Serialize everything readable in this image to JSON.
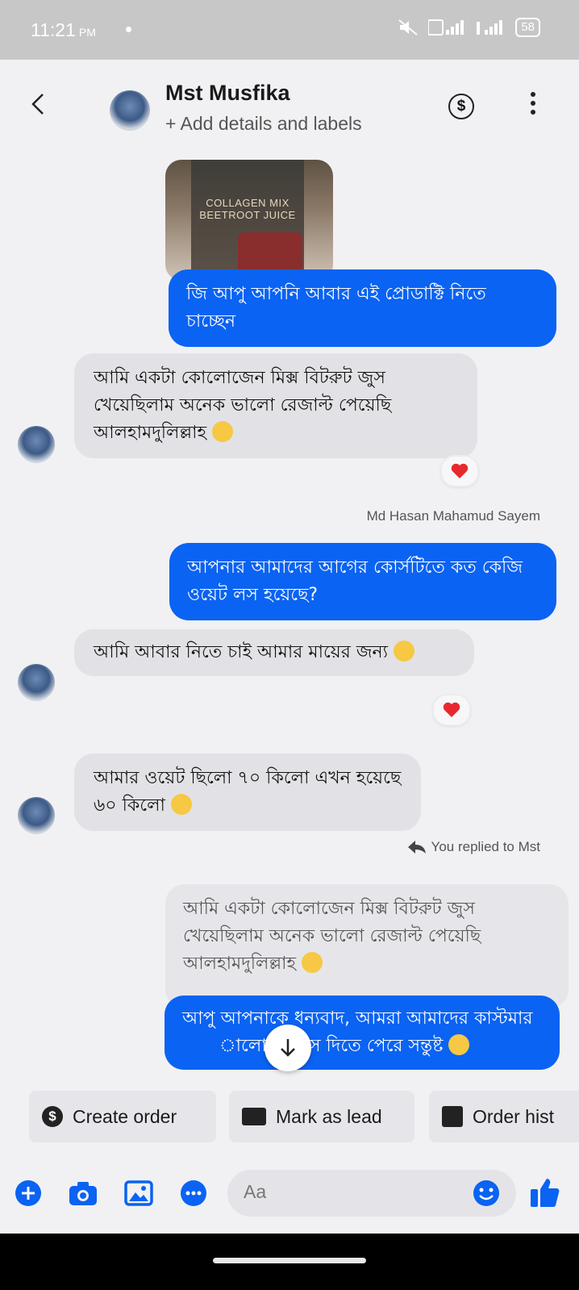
{
  "status_bar": {
    "time": "11:21",
    "ampm": "PM",
    "battery": "58"
  },
  "header": {
    "name": "Mst Musfika",
    "subtitle": "+ Add details and labels",
    "money_symbol": "$"
  },
  "image": {
    "line1": "COLLAGEN MIX",
    "line2": "BEETROOT JUICE"
  },
  "messages": [
    {
      "side": "out",
      "text": "জি আপু আপনি আবার এই প্রোডাক্টি নিতে চাচ্ছেন"
    },
    {
      "side": "in",
      "text": "আমি একটা কোলোজেন মিক্স বিটরুট জুস খেয়েছিলাম অনেক ভালো রেজাল্ট পেয়েছি আলহামদুলিল্লাহ",
      "emoji": "smiling-halo",
      "reaction": "heart"
    },
    {
      "side": "out",
      "sender": "Md Hasan Mahamud Sayem",
      "text": "আপনার আমাদের আগের কোর্সটিতে কত কেজি ওয়েট লস হয়েছে?"
    },
    {
      "side": "in",
      "text": "আমি আবার নিতে চাই আমার মায়ের জন্য",
      "emoji": "smiling-hearts",
      "reaction": "heart"
    },
    {
      "side": "in",
      "text": "আমার ওয়েট ছিলো ৭০ কিলো এখন হয়েছে ৬০ কিলো",
      "emoji": "smiling-halo"
    },
    {
      "side": "out",
      "replied_label": "You replied to Mst",
      "quoted": "আমি একটা কোলোজেন মিক্স বিটরুট জুস খেয়েছিলাম অনেক ভালো রেজাল্ট পেয়েছি আলহামদুলিল্লাহ",
      "text_part1": "আপু আপনাকে ধন্যবাদ, আমরা আমাদের কাস্টমার",
      "text_part2": "ালো জিনিস দিতে পেরে সন্তুষ্ট",
      "emoji": "smiling"
    }
  ],
  "chips": [
    {
      "label": "Create order",
      "icon": "dollar-icon"
    },
    {
      "label": "Mark as lead",
      "icon": "id-card-icon"
    },
    {
      "label": "Order hist",
      "icon": "list-icon"
    }
  ],
  "composer": {
    "placeholder": "Aa"
  },
  "colors": {
    "outgoing": "#0a63f2",
    "incoming": "#e2e2e6",
    "reaction_heart": "#e8282e",
    "accent": "#0a63f2"
  }
}
